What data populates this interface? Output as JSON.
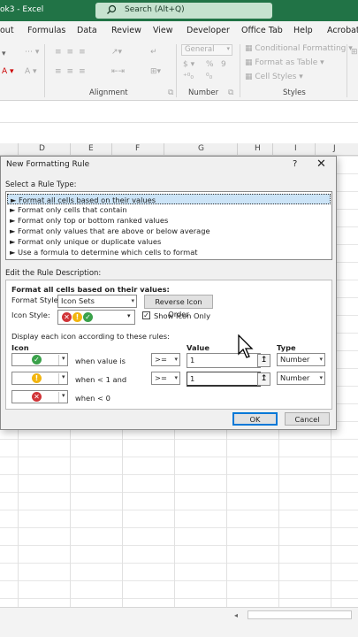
{
  "titlebar": {
    "doc": "ok3 - Excel",
    "search_placeholder": "Search (Alt+Q)"
  },
  "menu": [
    "out",
    "Formulas",
    "Data",
    "Review",
    "View",
    "Developer",
    "Office Tab",
    "Help",
    "Acrobat"
  ],
  "ribbon": {
    "number_format": "General",
    "percent": "%",
    "comma": "9",
    "currency": "$",
    "alignment_label": "Alignment",
    "number_label": "Number",
    "styles_label": "Styles",
    "conditional_formatting": "Conditional Formatting",
    "format_as_table": "Format as Table",
    "cell_styles": "Cell Styles"
  },
  "columns": [
    "D",
    "E",
    "F",
    "G",
    "H",
    "I",
    "J"
  ],
  "dialog": {
    "title": "New Formatting Rule",
    "help": "?",
    "close": "✕",
    "select_rule_type": "Select a Rule Type:",
    "rule_types": [
      "► Format all cells based on their values",
      "► Format only cells that contain",
      "► Format only top or bottom ranked values",
      "► Format only values that are above or below average",
      "► Format only unique or duplicate values",
      "► Use a formula to determine which cells to format"
    ],
    "edit_desc": "Edit the Rule Description:",
    "format_all_label": "Format all cells based on their values:",
    "format_style_label": "Format Style:",
    "format_style_value": "Icon Sets",
    "reverse_button": "Reverse Icon Order",
    "icon_style_label": "Icon Style:",
    "show_icon_only": "Show Icon Only",
    "display_rules_label": "Display each icon according to these rules:",
    "col_icon": "Icon",
    "col_value": "Value",
    "col_type": "Type",
    "rows": [
      {
        "icon": "check",
        "condition": "when value is",
        "operator": ">=",
        "value": "1",
        "type": "Number"
      },
      {
        "icon": "exclamation",
        "condition": "when < 1 and",
        "operator": ">=",
        "value": "1",
        "type": "Number"
      },
      {
        "icon": "cross",
        "condition": "when < 0",
        "operator": "",
        "value": "",
        "type": ""
      }
    ],
    "ok": "OK",
    "cancel": "Cancel"
  },
  "colors": {
    "excel_green": "#217346",
    "green_icon": "#3aa14a",
    "yellow_icon": "#f2b50f",
    "red_icon": "#d13438",
    "selection": "#cce4f7"
  }
}
